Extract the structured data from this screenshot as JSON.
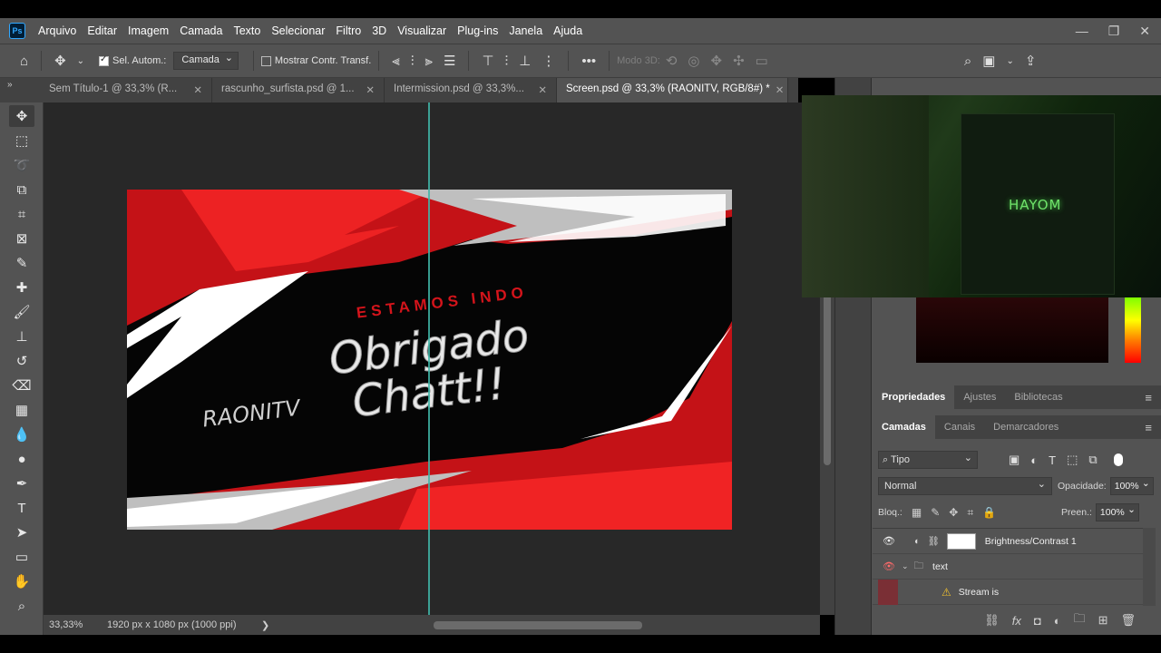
{
  "app": {
    "logo": "Ps",
    "menu": [
      "Arquivo",
      "Editar",
      "Imagem",
      "Camada",
      "Texto",
      "Selecionar",
      "Filtro",
      "3D",
      "Visualizar",
      "Plug-ins",
      "Janela",
      "Ajuda"
    ]
  },
  "window_controls": {
    "minimize": "—",
    "restore": "❐",
    "close": "✕"
  },
  "options": {
    "auto_select_label": "Sel. Autom.:",
    "auto_select_value": "Camada",
    "show_transform_label": "Mostrar Contr. Transf.",
    "mode3d_label": "Modo 3D:",
    "more": "•••"
  },
  "tabs": [
    {
      "label": "Sem Título-1 @ 33,3% (R...",
      "close": "✕",
      "active": false
    },
    {
      "label": "rascunho_surfista.psd @ 1...",
      "close": "✕",
      "active": false
    },
    {
      "label": "Intermission.psd @ 33,3%...",
      "close": "✕",
      "active": false
    },
    {
      "label": "Screen.psd @ 33,3% (RAONITV, RGB/8#) *",
      "close": "✕",
      "active": true
    }
  ],
  "artwork": {
    "subtitle": "ESTAMOS INDO",
    "line1": "Obrigado",
    "line2": "Chatt!!",
    "brand": "RAONITV"
  },
  "status": {
    "zoom": "33,33%",
    "doc": "1920 px x 1080 px (1000 ppi)",
    "arrow": "❯"
  },
  "webcam": {
    "caption": "HAYOM"
  },
  "panels": {
    "top_tabs": [
      "Propriedades",
      "Ajustes",
      "Bibliotecas"
    ],
    "layer_tabs": [
      "Camadas",
      "Canais",
      "Demarcadores"
    ],
    "filter_value": "Tipo",
    "blend_mode": "Normal",
    "opacity_label": "Opacidade:",
    "opacity_value": "100%",
    "lock_label": "Bloq.:",
    "fill_label": "Preen.:",
    "fill_value": "100%"
  },
  "layers": [
    {
      "name": "Brightness/Contrast 1",
      "type": "adjustment"
    },
    {
      "name": "text",
      "type": "group"
    },
    {
      "name": "Stream is",
      "type": "text-warning"
    }
  ],
  "colors": {
    "accent_red": "#e01b22",
    "guide": "#3fb6a8",
    "ui_dark": "#535353",
    "canvas_bg": "#282828"
  }
}
